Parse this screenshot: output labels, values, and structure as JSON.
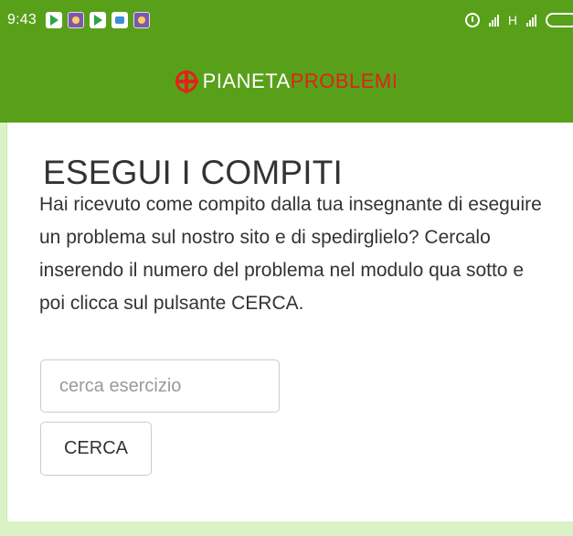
{
  "status_bar": {
    "time": "9:43",
    "network_label": "H",
    "icons": [
      "play-store-icon",
      "game-icon",
      "play-store-icon",
      "robot-icon",
      "game-icon",
      "alarm-icon",
      "signal-icon",
      "battery-icon"
    ]
  },
  "header": {
    "logo_part1": "PIANETA",
    "logo_part2": "PROBLEMI",
    "colors": {
      "primary": "#58a019",
      "accent": "#e0221b"
    }
  },
  "main": {
    "title": "ESEGUI I COMPITI",
    "description": "Hai ricevuto come compito dalla tua insegnante di eseguire un problema sul nostro sito e di spedirglielo? Cercalo inserendo il numero del problema nel modulo qua sotto e poi clicca sul pulsante CERCA.",
    "search_placeholder": "cerca esercizio",
    "search_value": "",
    "search_button_label": "CERCA"
  }
}
